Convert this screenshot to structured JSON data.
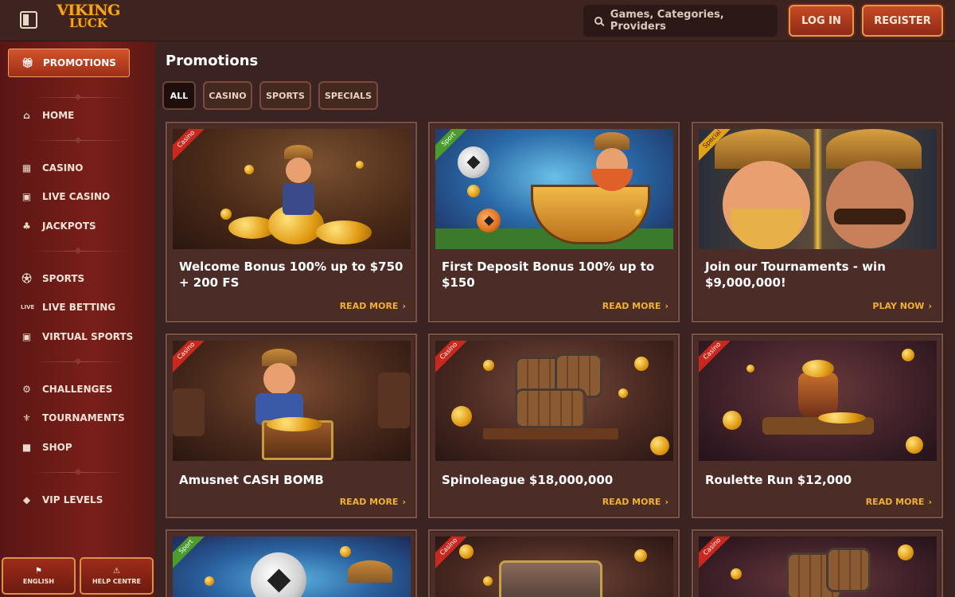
{
  "header": {
    "logo_line1": "VIKING",
    "logo_line2": "LUCK",
    "search_placeholder": "Games, Categories, Providers",
    "login_label": "LOG IN",
    "register_label": "REGISTER"
  },
  "sidebar": {
    "promotions": {
      "label": "PROMOTIONS",
      "icon": "gift-icon"
    },
    "groups": [
      [
        {
          "label": "HOME",
          "icon": "home-icon"
        }
      ],
      [
        {
          "label": "CASINO",
          "icon": "slot-machine-icon"
        },
        {
          "label": "LIVE CASINO",
          "icon": "live-casino-icon"
        },
        {
          "label": "JACKPOTS",
          "icon": "clover-icon"
        }
      ],
      [
        {
          "label": "SPORTS",
          "icon": "ball-icon"
        },
        {
          "label": "LIVE BETTING",
          "icon": "live-icon"
        },
        {
          "label": "VIRTUAL SPORTS",
          "icon": "virtual-icon"
        }
      ],
      [
        {
          "label": "CHALLENGES",
          "icon": "gear-icon"
        },
        {
          "label": "TOURNAMENTS",
          "icon": "trophy-icon"
        },
        {
          "label": "SHOP",
          "icon": "bag-icon"
        }
      ],
      [
        {
          "label": "VIP LEVELS",
          "icon": "diamond-icon"
        }
      ]
    ],
    "language_label": "ENGLISH",
    "help_label": "HELP CENTRE"
  },
  "main": {
    "title": "Promotions",
    "filters": [
      {
        "label": "ALL",
        "active": true
      },
      {
        "label": "CASINO",
        "active": false
      },
      {
        "label": "SPORTS",
        "active": false
      },
      {
        "label": "SPECIALS",
        "active": false
      }
    ],
    "cards": [
      {
        "tag": "Casino",
        "title": "Welcome Bonus 100% up to $750 + 200 FS",
        "link": "READ MORE"
      },
      {
        "tag": "Sport",
        "title": "First Deposit Bonus 100% up to $150",
        "link": "READ MORE"
      },
      {
        "tag": "Special",
        "title": "Join our Tournaments - win $9,000,000!",
        "link": "PLAY NOW"
      },
      {
        "tag": "Casino",
        "title": "Amusnet CASH BOMB",
        "link": "READ MORE"
      },
      {
        "tag": "Casino",
        "title": "Spinoleague $18,000,000",
        "link": "READ MORE"
      },
      {
        "tag": "Casino",
        "title": "Roulette Run $12,000",
        "link": "READ MORE"
      },
      {
        "tag": "Sport",
        "title": "",
        "link": ""
      },
      {
        "tag": "Casino",
        "title": "",
        "link": ""
      },
      {
        "tag": "Casino",
        "title": "",
        "link": ""
      }
    ]
  },
  "colors": {
    "background": "#3a2320",
    "sidebar": "#7a1e1a",
    "accent": "#f0b030",
    "button": "#b2401f",
    "tag_casino": "#c8281e",
    "tag_sport": "#4a9c2e",
    "tag_special": "#e0a21a"
  }
}
